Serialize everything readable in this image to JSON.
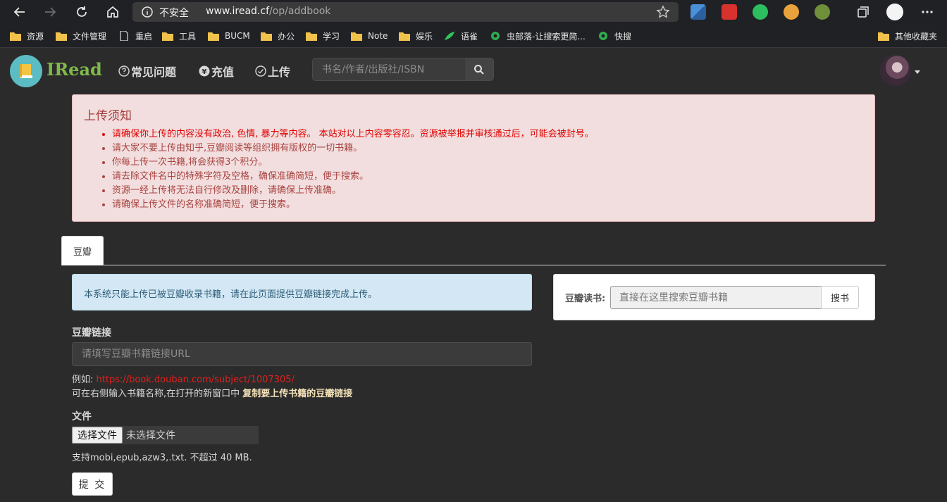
{
  "browser": {
    "insecure_label": "不安全",
    "url_host": "www.iread.cf",
    "url_path": "/op/addbook"
  },
  "bookmarks": [
    {
      "label": "资源",
      "icon": "folder-icon"
    },
    {
      "label": "文件管理",
      "icon": "folder-icon"
    },
    {
      "label": "重启",
      "icon": "page-icon"
    },
    {
      "label": "工具",
      "icon": "folder-icon"
    },
    {
      "label": "BUCM",
      "icon": "folder-icon"
    },
    {
      "label": "办公",
      "icon": "folder-icon"
    },
    {
      "label": "学习",
      "icon": "folder-icon"
    },
    {
      "label": "Note",
      "icon": "folder-icon"
    },
    {
      "label": "娱乐",
      "icon": "folder-icon"
    },
    {
      "label": "语雀",
      "icon": "yuque-icon"
    },
    {
      "label": "虫部落-让搜索更简...",
      "icon": "chongbuluo-icon"
    },
    {
      "label": "快搜",
      "icon": "chongbuluo-icon"
    }
  ],
  "other_bookmarks": "其他收藏夹",
  "site": {
    "logo_text": "IRead",
    "nav": {
      "faq": "常见问题",
      "recharge": "充值",
      "upload": "上传"
    },
    "search_placeholder": "书名/作者/出版社/ISBN"
  },
  "notice": {
    "title": "上传须知",
    "items": [
      "请确保你上传的内容没有政治, 色情, 暴力等内容。 本站对以上内容零容忍。资源被举报并审核通过后，可能会被封号。",
      "请大家不要上传由知乎,豆瓣阅读等组织拥有版权的一切书籍。",
      "你每上传一次书籍,将会获得3个积分。",
      "请去除文件名中的特殊字符及空格，确保准确简短，便于搜索。",
      "资源一经上传将无法自行修改及删除，请确保上传准确。",
      "请确保上传文件的名称准确简短，便于搜索。"
    ]
  },
  "tabs": [
    "豆瓣"
  ],
  "form": {
    "info": "本系统只能上传已被豆瓣收录书籍，请在此页面提供豆瓣链接完成上传。",
    "link_label": "豆瓣链接",
    "link_placeholder": "请填写豆瓣书籍链接URL",
    "example_prefix": "例如: ",
    "example_url": "https://book.douban.com/subject/1007305/",
    "hint_prefix": "可在右侧输入书籍名称,在打开的新窗口中 ",
    "hint_bold": "复制要上传书籍的豆瓣链接",
    "file_label": "文件",
    "file_button": "选择文件",
    "file_none": "未选择文件",
    "file_hint": "支持mobi,epub,azw3,.txt. 不超过 40 MB.",
    "submit": "提 交"
  },
  "douban_search": {
    "label": "豆瓣读书:",
    "placeholder": "直接在这里搜索豆瓣书籍",
    "button": "搜书"
  },
  "colors": {
    "notice_bg": "#f2dede",
    "warning_red": "#e00000",
    "info_bg": "#d3e8f4",
    "logo_green": "#7fb94a",
    "logo_circle": "#5bbcc4"
  }
}
